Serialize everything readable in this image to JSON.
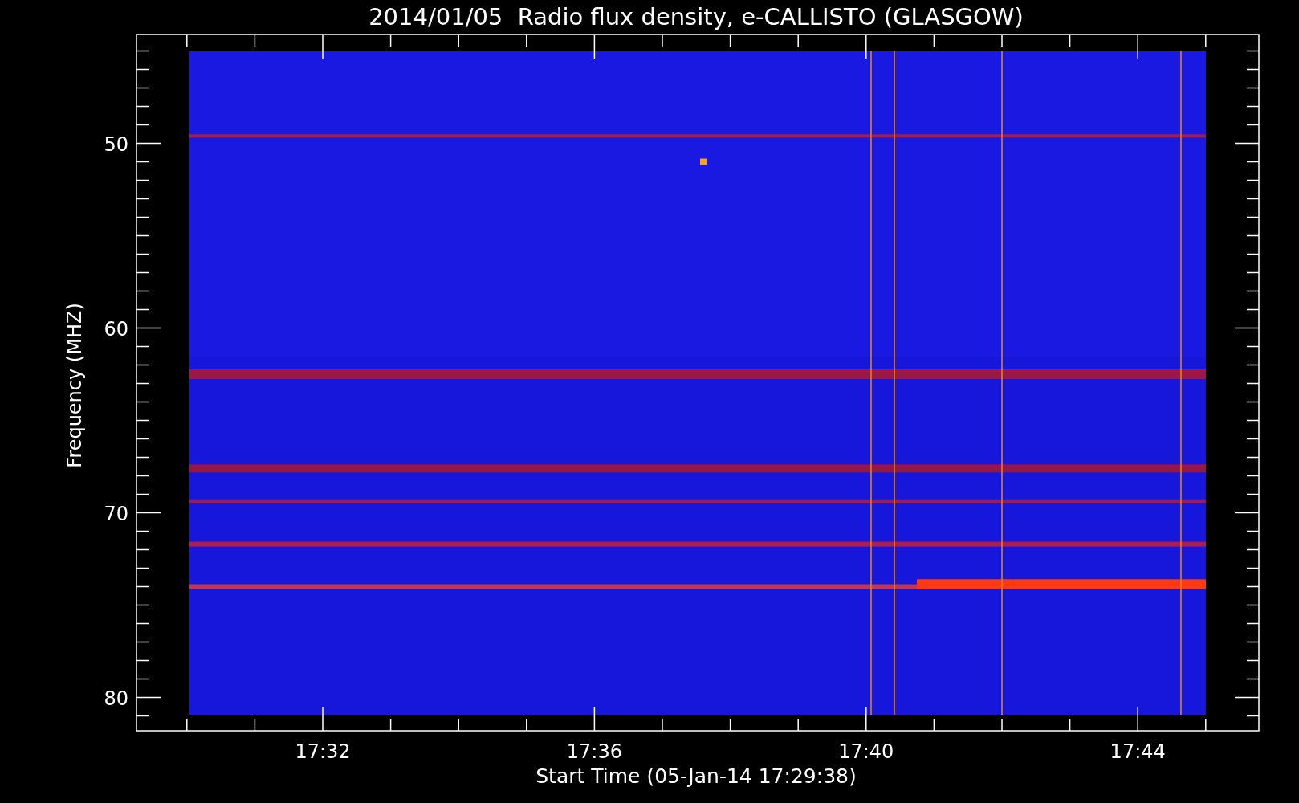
{
  "title": "2014/01/05  Radio flux density, e-CALLISTO (GLASGOW)",
  "y_axis": {
    "label": "Frequency (MHZ)",
    "ticks": [
      "50",
      "60",
      "70",
      "80"
    ]
  },
  "x_axis": {
    "label": "Start Time (05-Jan-14 17:29:38)",
    "ticks": [
      "17:32",
      "17:36",
      "17:40",
      "17:44"
    ]
  }
}
